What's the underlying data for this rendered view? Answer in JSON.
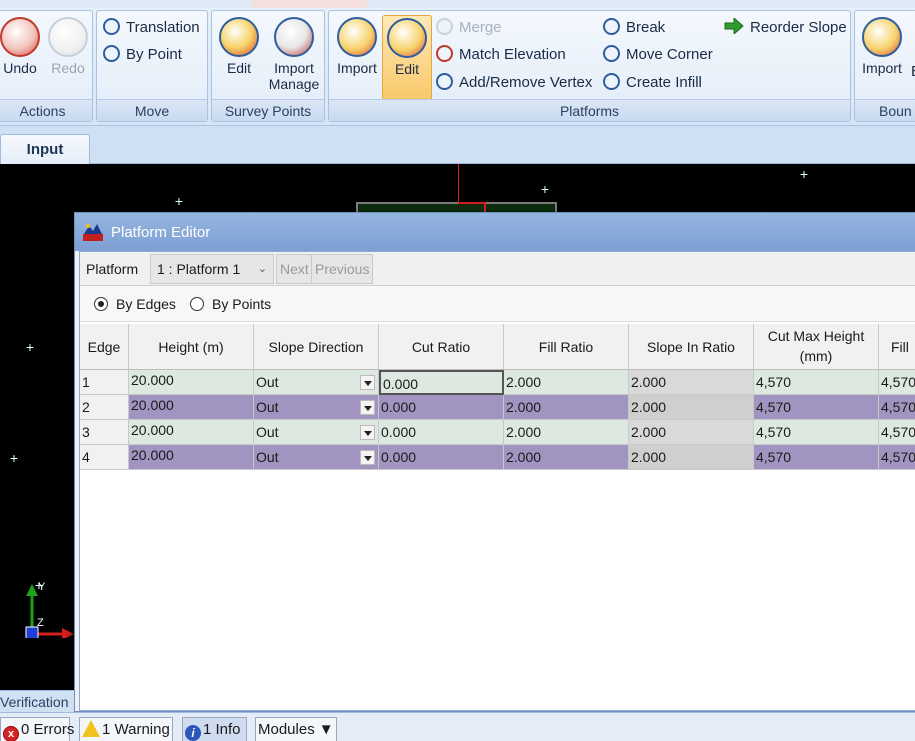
{
  "ribbon": {
    "actions": {
      "label": "Actions",
      "undo": "Undo",
      "redo": "Redo"
    },
    "move": {
      "label": "Move",
      "translation": "Translation",
      "by_point": "By Point"
    },
    "survey_points": {
      "label": "Survey Points",
      "edit": "Edit",
      "import_manage_1": "Import",
      "import_manage_2": "Manage"
    },
    "platforms": {
      "label": "Platforms",
      "import": "Import",
      "edit": "Edit",
      "merge": "Merge",
      "match_elevation": "Match Elevation",
      "add_remove_vertex": "Add/Remove Vertex",
      "break": "Break",
      "move_corner": "Move Corner",
      "create_infill": "Create Infill",
      "reorder_slope": "Reorder Slope"
    },
    "boundary": {
      "label": "Boun",
      "import": "Import",
      "extra": "E"
    }
  },
  "tabs": {
    "input": "Input"
  },
  "editor": {
    "title": "Platform Editor",
    "platform_label": "Platform",
    "platform_selected": "1 : Platform 1",
    "next": "Next",
    "previous": "Previous",
    "mode_by_edges": "By Edges",
    "mode_by_points": "By Points",
    "columns": {
      "edge": "Edge",
      "height": "Height (m)",
      "slope_direction": "Slope Direction",
      "cut_ratio": "Cut Ratio",
      "fill_ratio": "Fill Ratio",
      "slope_in_ratio": "Slope In Ratio",
      "cut_max_height": "Cut Max Height (mm)",
      "fill": "Fill"
    },
    "rows": [
      {
        "edge": "1",
        "height": "20.000",
        "dir": "Out",
        "cut": "0.000",
        "fill": "2.000",
        "slope_in": "2.000",
        "cut_max": "4,570",
        "fill_max": "4,570"
      },
      {
        "edge": "2",
        "height": "20.000",
        "dir": "Out",
        "cut": "0.000",
        "fill": "2.000",
        "slope_in": "2.000",
        "cut_max": "4,570",
        "fill_max": "4,570"
      },
      {
        "edge": "3",
        "height": "20.000",
        "dir": "Out",
        "cut": "0.000",
        "fill": "2.000",
        "slope_in": "2.000",
        "cut_max": "4,570",
        "fill_max": "4,570"
      },
      {
        "edge": "4",
        "height": "20.000",
        "dir": "Out",
        "cut": "0.000",
        "fill": "2.000",
        "slope_in": "2.000",
        "cut_max": "4,570",
        "fill_max": "4,570"
      }
    ]
  },
  "canvas": {
    "axis_y": "Y",
    "axis_z": "Z"
  },
  "left_panel": {
    "verification": "Verification"
  },
  "status": {
    "errors": "0 Errors",
    "warnings": "1 Warning",
    "info": "1 Info",
    "modules": "Modules"
  },
  "colors": {
    "row_odd": "#dce8e0",
    "row_even": "#a294c0",
    "ribbon_active": "#f9c96b"
  }
}
